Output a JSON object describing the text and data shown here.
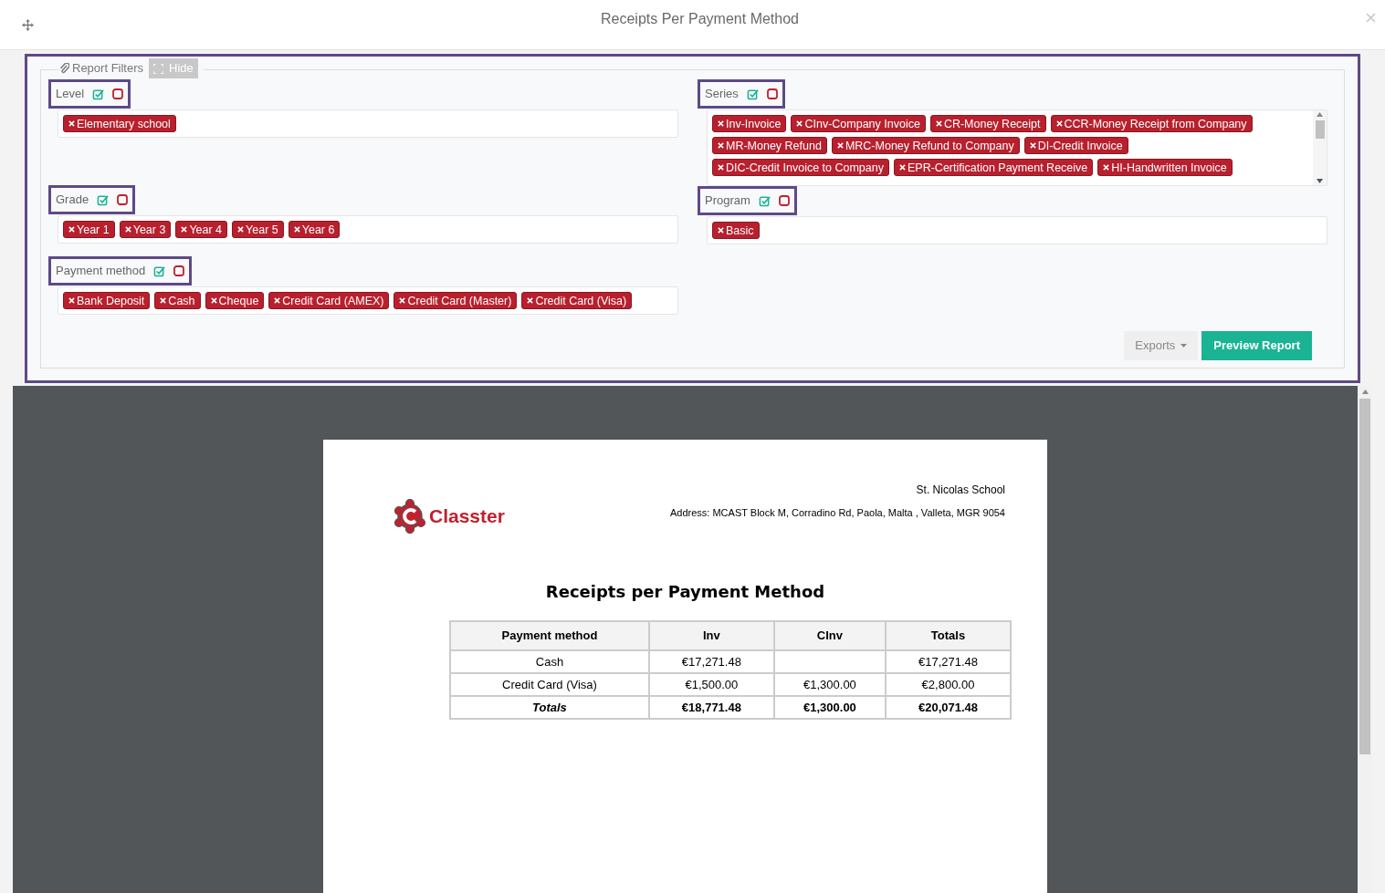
{
  "dialog": {
    "title": "Receipts Per Payment Method"
  },
  "filters_panel": {
    "legend": "Report Filters",
    "hide_button": "Hide",
    "left_filters": [
      {
        "label": "Level",
        "tags": [
          "Elementary school"
        ]
      },
      {
        "label": "Grade",
        "tags": [
          "Year 1",
          "Year 3",
          "Year 4",
          "Year 5",
          "Year 6"
        ]
      },
      {
        "label": "Payment method",
        "tags": [
          "Bank Deposit",
          "Cash",
          "Cheque",
          "Credit Card (AMEX)",
          "Credit Card (Master)",
          "Credit Card (Visa)"
        ]
      }
    ],
    "right_filters": [
      {
        "label": "Series",
        "tags": [
          "Inv-Invoice",
          "CInv-Company Invoice",
          "CR-Money Receipt",
          "CCR-Money Receipt from Company",
          "MR-Money Refund",
          "MRC-Money Refund to Company",
          "DI-Credit Invoice",
          "DIC-Credit Invoice to Company",
          "EPR-Certification Payment Receive",
          "HI-Handwritten Invoice"
        ],
        "scrollable": true
      },
      {
        "label": "Program",
        "tags": [
          "Basic"
        ],
        "scrollable": false
      }
    ],
    "exports_button": "Exports",
    "preview_button": "Preview Report"
  },
  "report": {
    "logo_text": "Classter",
    "school": "St. Nicolas School",
    "address": "Address: MCAST Block M, Corradino Rd, Paola, Malta , Valleta, MGR 9054",
    "title": "Receipts per Payment Method",
    "table": {
      "columns": [
        "Payment method",
        "Inv",
        "CInv",
        "Totals"
      ],
      "rows": [
        {
          "kind": "data",
          "cells": [
            "Cash",
            "€17,271.48",
            "",
            "€17,271.48"
          ]
        },
        {
          "kind": "data",
          "cells": [
            "Credit Card (Visa)",
            "€1,500.00",
            "€1,300.00",
            "€2,800.00"
          ]
        },
        {
          "kind": "total",
          "cells": [
            "Totals",
            "€18,771.48",
            "€1,300.00",
            "€20,071.48"
          ]
        }
      ]
    }
  }
}
